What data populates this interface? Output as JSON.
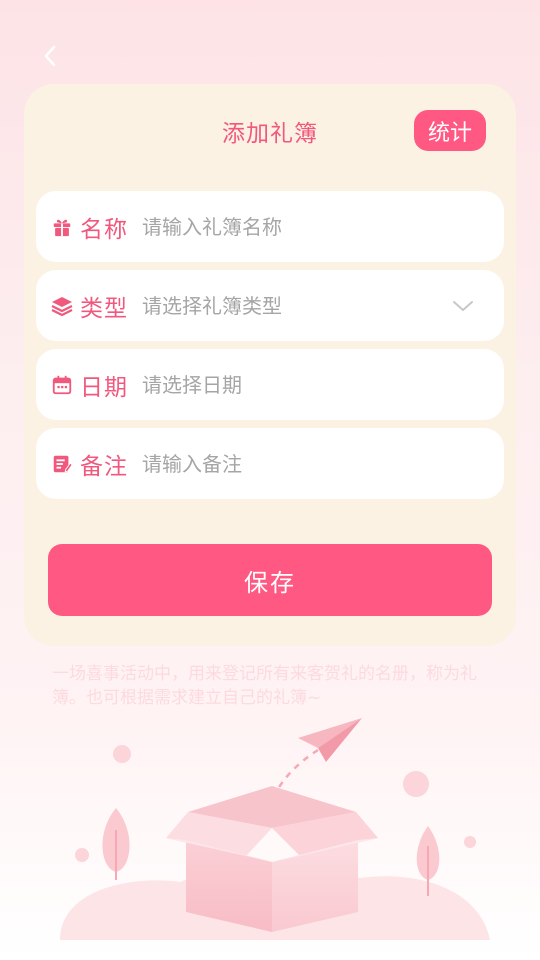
{
  "header": {
    "back_icon": "chevron-left-icon"
  },
  "card": {
    "title": "添加礼簿",
    "stats_label": "统计"
  },
  "form": {
    "name": {
      "icon": "gift-icon",
      "label": "名称",
      "placeholder": "请输入礼簿名称"
    },
    "type": {
      "icon": "layers-icon",
      "label": "类型",
      "placeholder": "请选择礼簿类型",
      "dropdown_icon": "chevron-down-icon"
    },
    "date": {
      "icon": "calendar-icon",
      "label": "日期",
      "placeholder": "请选择日期"
    },
    "note": {
      "icon": "note-icon",
      "label": "备注",
      "placeholder": "请输入备注"
    }
  },
  "save_label": "保存",
  "description": "一场喜事活动中，用来登记所有来客贺礼的名册，称为礼簿。也可根据需求建立自己的礼簿~",
  "colors": {
    "accent": "#ff5983",
    "label": "#f0587d",
    "card_bg": "#fbf2e3"
  }
}
